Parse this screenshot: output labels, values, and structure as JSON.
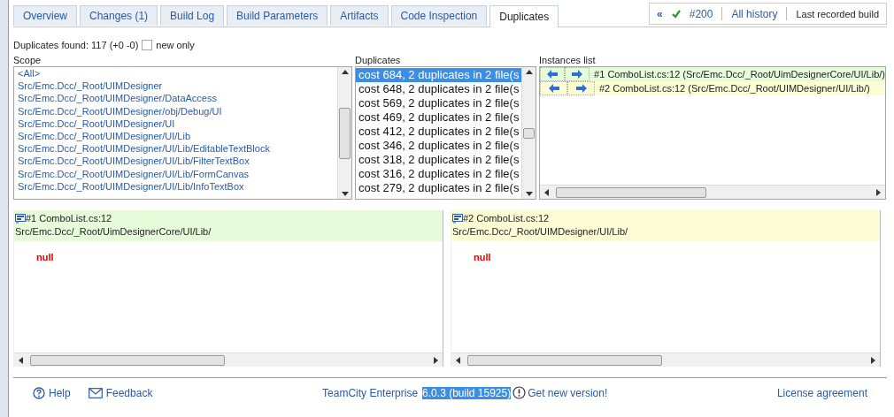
{
  "tabs": [
    {
      "label": "Overview",
      "selected": false
    },
    {
      "label": "Changes (1)",
      "selected": false
    },
    {
      "label": "Build Log",
      "selected": false
    },
    {
      "label": "Build Parameters",
      "selected": false
    },
    {
      "label": "Artifacts",
      "selected": false
    },
    {
      "label": "Code Inspection",
      "selected": false
    },
    {
      "label": "Duplicates",
      "selected": true
    }
  ],
  "history": {
    "prev": "«",
    "build": "#200",
    "all": "All history",
    "last": "Last recorded build"
  },
  "summary": {
    "text": "Duplicates found: 117 (+0 -0)",
    "new_only": {
      "label": "new only",
      "checked": false
    }
  },
  "scope": {
    "title": "Scope",
    "items": [
      "<All>",
      "Src/Emc.Dcc/_Root/UIMDesigner",
      "Src/Emc.Dcc/_Root/UIMDesigner/DataAccess",
      "Src/Emc.Dcc/_Root/UIMDesigner/obj/Debug/UI",
      "Src/Emc.Dcc/_Root/UIMDesigner/UI",
      "Src/Emc.Dcc/_Root/UIMDesigner/UI/Lib",
      "Src/Emc.Dcc/_Root/UIMDesigner/UI/Lib/EditableTextBlock",
      "Src/Emc.Dcc/_Root/UIMDesigner/UI/Lib/FilterTextBox",
      "Src/Emc.Dcc/_Root/UIMDesigner/UI/Lib/FormCanvas",
      "Src/Emc.Dcc/_Root/UIMDesigner/UI/Lib/InfoTextBox"
    ]
  },
  "duplicates": {
    "title": "Duplicates",
    "items": [
      {
        "label": "cost 684, 2 duplicates in 2 file(s",
        "selected": true
      },
      {
        "label": "cost 648, 2 duplicates in 2 file(s",
        "selected": false
      },
      {
        "label": "cost 569, 2 duplicates in 2 file(s",
        "selected": false
      },
      {
        "label": "cost 469, 2 duplicates in 2 file(s",
        "selected": false
      },
      {
        "label": "cost 412, 2 duplicates in 2 file(s",
        "selected": false
      },
      {
        "label": "cost 346, 2 duplicates in 2 file(s",
        "selected": false
      },
      {
        "label": "cost 318, 2 duplicates in 2 file(s",
        "selected": false
      },
      {
        "label": "cost 316, 2 duplicates in 2 file(s",
        "selected": false
      },
      {
        "label": "cost 279, 2 duplicates in 2 file(s",
        "selected": false
      }
    ]
  },
  "instances": {
    "title": "Instances list",
    "items": [
      {
        "label": "#1 ComboList.cs:12 (Src/Emc.Dcc/_Root/UimDesignerCore/UI/Lib/)",
        "color": "#e6fbd9"
      },
      {
        "label": "#2 ComboList.cs:12 (Src/Emc.Dcc/_Root/UIMDesigner/UI/Lib/)",
        "color": "#fdfdd5"
      }
    ]
  },
  "panes": [
    {
      "title": "#1 ComboList.cs:12",
      "path": "Src/Emc.Dcc/_Root/UimDesignerCore/UI/Lib/",
      "code": "null",
      "color": "#e6fbd9"
    },
    {
      "title": "#2 ComboList.cs:12",
      "path": "Src/Emc.Dcc/_Root/UIMDesigner/UI/Lib/",
      "code": "null",
      "color": "#fdfdd5"
    }
  ],
  "footer": {
    "help": "Help",
    "feedback": "Feedback",
    "product": "TeamCity Enterprise",
    "version": {
      "text": "6.0.3 (build 15925)",
      "highlighted": true
    },
    "update": "Get new version!",
    "license": "License agreement"
  }
}
